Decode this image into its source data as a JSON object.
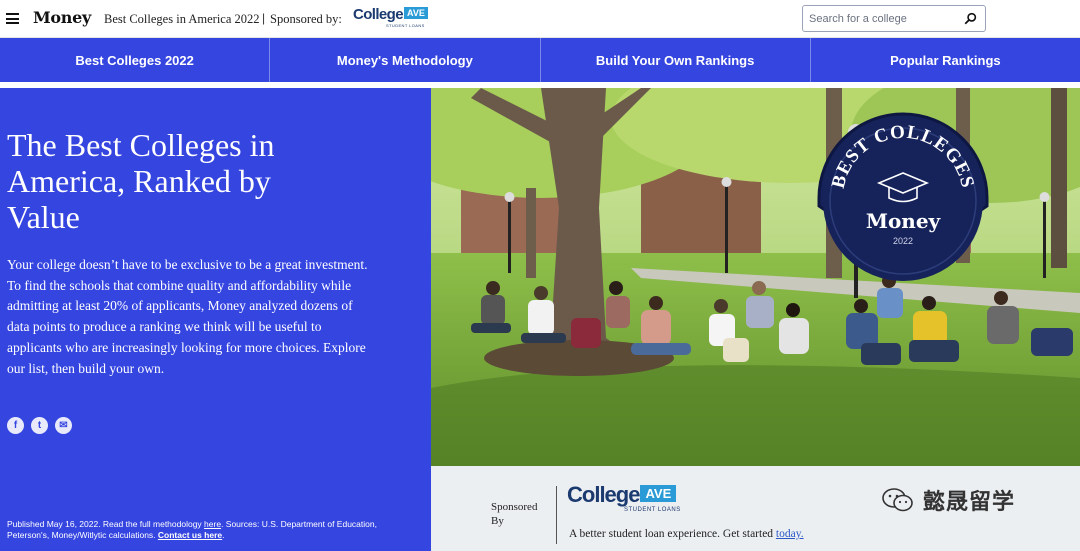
{
  "header": {
    "logo": "Money",
    "tagline": "Best Colleges in America 2022",
    "separator": "|",
    "sponsored_by": "Sponsored by:",
    "sponsor_name": "College",
    "sponsor_ave": "AVE",
    "sponsor_sub": "STUDENT LOANS",
    "search_placeholder": "Search for a college"
  },
  "nav": {
    "items": [
      {
        "label": "Best Colleges 2022"
      },
      {
        "label": "Money's Methodology"
      },
      {
        "label": "Build Your Own Rankings"
      },
      {
        "label": "Popular Rankings"
      }
    ]
  },
  "hero": {
    "title": "The Best Colleges in America, Ranked by Value",
    "body": "Your college doesn’t have to be exclusive to be a great investment. To find the schools that combine quality and affordability while admitting at least 20% of applicants, Money analyzed dozens of data points to produce a ranking we think will be useful to applicants who are increasingly looking for more choices. Explore our list, then build your own.",
    "social": [
      "f",
      "t",
      "✉"
    ],
    "footnote": {
      "part1": "Published May 16, 2022. Read the full methodology ",
      "methodology_link": "here",
      "part2": ". Sources: U.S. Department of Education, Peterson's, Money/Witlytic calculations. ",
      "contact_link": "Contact us here",
      "part3": "."
    }
  },
  "badge": {
    "arc_text": "BEST COLLEGES",
    "brand": "Money",
    "year": "2022"
  },
  "sponsor_panel": {
    "label_line1": "Sponsored",
    "label_line2": "By",
    "name": "College",
    "ave": "AVE",
    "sub": "STUDENT LOANS",
    "tagline": "A better student loan experience. Get started ",
    "link": "today."
  },
  "watermark": {
    "text": "懿晟留学"
  }
}
